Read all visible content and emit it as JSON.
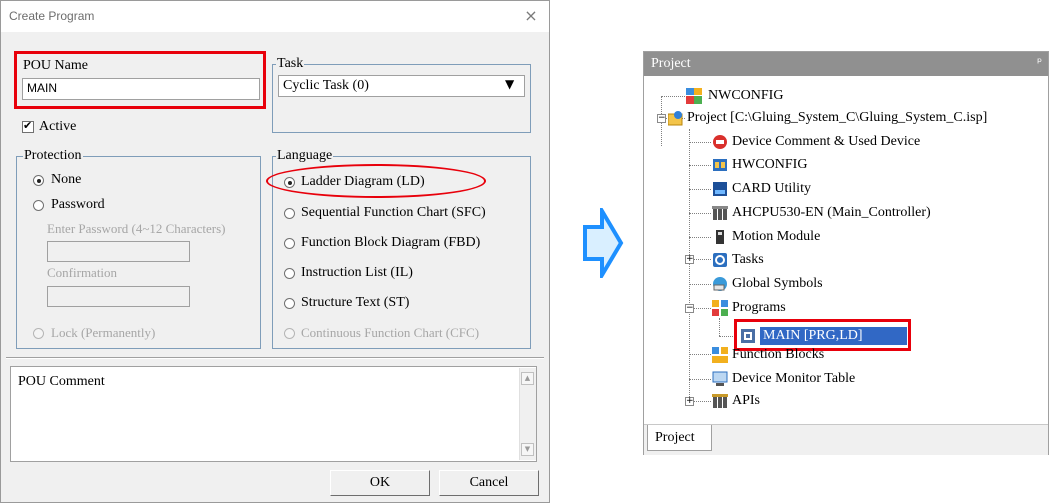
{
  "dialog": {
    "title": "Create Program",
    "close_glyph": "×",
    "pou_name_label": "POU Name",
    "pou_name_value": "MAIN",
    "active_label": "Active",
    "task_label": "Task",
    "task_value": "Cyclic Task (0)",
    "protection_label": "Protection",
    "protection_options": [
      "None",
      "Password",
      "Lock (Permanently)"
    ],
    "password_label": "Enter Password (4~12 Characters)",
    "confirmation_label": "Confirmation",
    "language_label": "Language",
    "language_options": [
      "Ladder Diagram (LD)",
      "Sequential Function Chart (SFC)",
      "Function Block Diagram (FBD)",
      "Instruction List (IL)",
      "Structure Text (ST)",
      "Continuous Function Chart (CFC)"
    ],
    "pou_comment_label": "POU Comment",
    "ok_label": "OK",
    "cancel_label": "Cancel"
  },
  "project_panel": {
    "title": "Project",
    "pin_glyph": "ᵖ",
    "tree": [
      "NWCONFIG",
      "Project [C:\\Gluing_System_C\\Gluing_System_C.isp]",
      "Device Comment & Used Device",
      "HWCONFIG",
      "CARD Utility",
      "AHCPU530-EN  (Main_Controller)",
      "Motion Module",
      "Tasks",
      "Global Symbols",
      "Programs",
      "MAIN [PRG,LD]",
      "Function Blocks",
      "Device Monitor Table",
      "APIs"
    ],
    "tab_label": "Project"
  },
  "colors": {
    "highlight": "#e8000b",
    "arrow": "#1e90ff",
    "selection": "#3168c5"
  }
}
